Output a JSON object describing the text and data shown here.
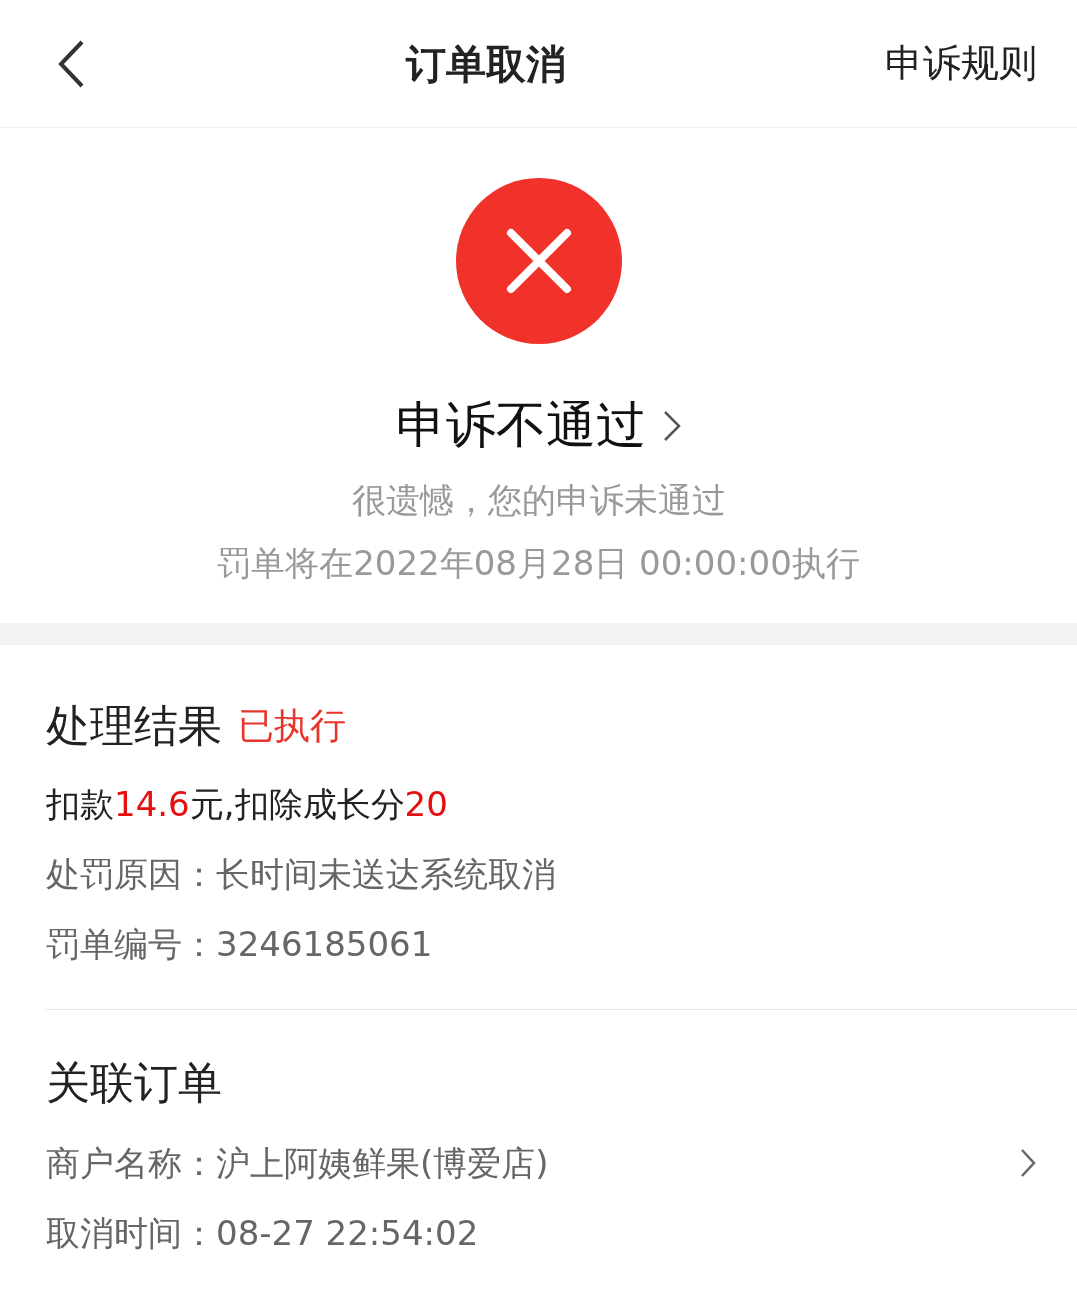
{
  "header": {
    "title": "订单取消",
    "action": "申诉规则"
  },
  "status": {
    "title": "申诉不通过",
    "message": "很遗憾，您的申诉未通过",
    "schedule": "罚单将在2022年08月28日 00:00:00执行"
  },
  "result": {
    "heading": "处理结果",
    "status": "已执行",
    "summary": [
      {
        "text": "扣款",
        "highlight": false
      },
      {
        "text": "14.6",
        "highlight": true
      },
      {
        "text": "元,扣除成长分",
        "highlight": false
      },
      {
        "text": "20",
        "highlight": true
      }
    ],
    "rows": [
      {
        "label": "处罚原因：",
        "value": "长时间未送达系统取消"
      },
      {
        "label": "罚单编号：",
        "value": "3246185061"
      }
    ]
  },
  "related": {
    "heading": "关联订单",
    "rows": [
      {
        "label": "商户名称：",
        "value": "沪上阿姨鲜果(博爱店)",
        "link": true
      },
      {
        "label": "取消时间：",
        "value": "08-27 22:54:02",
        "link": false
      }
    ]
  }
}
